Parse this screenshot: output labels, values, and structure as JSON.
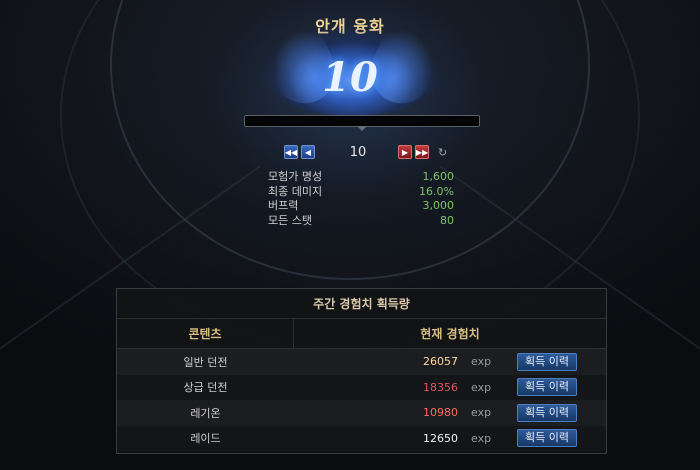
{
  "title": "안개 융화",
  "level_display": "10",
  "stepper": {
    "value": "10",
    "first_icon": "double-left-arrow-icon",
    "prev_icon": "left-arrow-icon",
    "next_icon": "right-arrow-icon",
    "last_icon": "double-right-arrow-icon",
    "refresh_icon": "refresh-icon"
  },
  "stats": [
    {
      "label": "모험가 명성",
      "value": "1,600"
    },
    {
      "label": "최종 데미지",
      "value": "16.0%"
    },
    {
      "label": "버프력",
      "value": "3,000"
    },
    {
      "label": "모든 스탯",
      "value": "80"
    }
  ],
  "panel": {
    "title": "주간 경험치 획득량",
    "col_content": "콘텐츠",
    "col_exp": "현재 경험치",
    "rows": [
      {
        "name": "일반 던전",
        "value": "26057",
        "unit": "exp",
        "button": "획득 이력",
        "color": "#ffd9a0"
      },
      {
        "name": "상급 던전",
        "value": "18356",
        "unit": "exp",
        "button": "획득 이력",
        "color": "#e0555a"
      },
      {
        "name": "레기온",
        "value": "10980",
        "unit": "exp",
        "button": "획득 이력",
        "color": "#ff6a5a"
      },
      {
        "name": "레이드",
        "value": "12650",
        "unit": "exp",
        "button": "획득 이력",
        "color": "#f2f2f2"
      }
    ]
  }
}
